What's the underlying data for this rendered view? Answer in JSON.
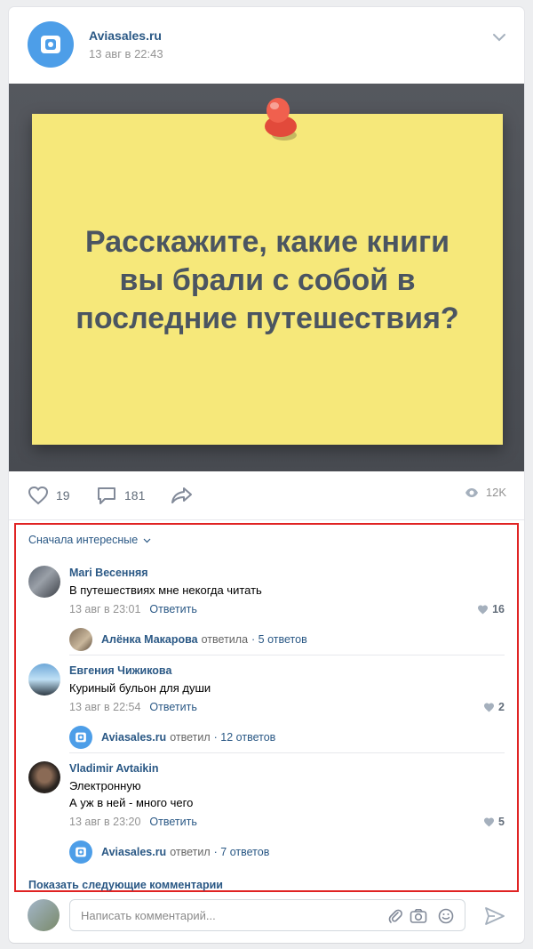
{
  "post": {
    "author": "Aviasales.ru",
    "date": "13 авг в 22:43",
    "image_text": [
      "Расскажите, какие книги",
      "вы брали с собой в",
      "последние путешествия?"
    ]
  },
  "actions": {
    "likes": "19",
    "comments": "181",
    "views": "12K"
  },
  "comments": {
    "sort_label": "Сначала интересные",
    "items": [
      {
        "name": "Mari Весенняя",
        "lines": [
          "В путешествиях мне некогда читать"
        ],
        "date": "13 авг в 23:01",
        "reply_label": "Ответить",
        "likes": "16",
        "thread": {
          "name": "Алёнка Макарова",
          "verb": "ответила",
          "count": "5 ответов"
        }
      },
      {
        "name": "Евгения Чижикова",
        "lines": [
          "Куриный бульон для души"
        ],
        "date": "13 авг в 22:54",
        "reply_label": "Ответить",
        "likes": "2",
        "thread": {
          "name": "Aviasales.ru",
          "verb": "ответил",
          "count": "12 ответов"
        }
      },
      {
        "name": "Vladimir Avtaikin",
        "lines": [
          "Электронную",
          "А уж в ней - много чего"
        ],
        "date": "13 авг в 23:20",
        "reply_label": "Ответить",
        "likes": "5",
        "thread": {
          "name": "Aviasales.ru",
          "verb": "ответил",
          "count": "7 ответов"
        }
      }
    ],
    "show_more": "Показать следующие комментарии"
  },
  "composer": {
    "placeholder": "Написать комментарий..."
  },
  "colors": {
    "link": "#2a5885",
    "brand": "#4d9ee8",
    "highlight_border": "#e02323",
    "sticky": "#f6e87a"
  }
}
